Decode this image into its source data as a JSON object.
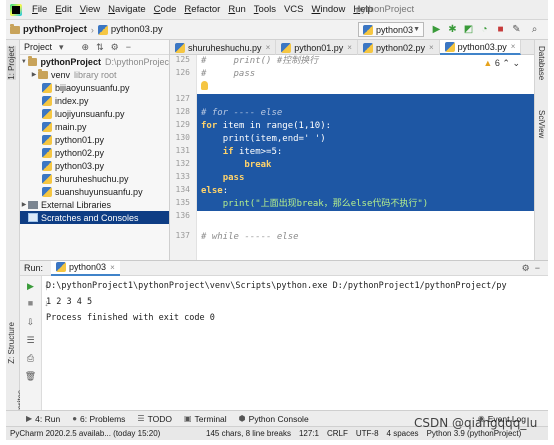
{
  "menubar": {
    "items": [
      {
        "label": "File",
        "mnemonic": "F",
        "rest": "ile"
      },
      {
        "label": "Edit",
        "mnemonic": "E",
        "rest": "dit"
      },
      {
        "label": "View",
        "mnemonic": "V",
        "rest": "iew"
      },
      {
        "label": "Navigate",
        "mnemonic": "N",
        "rest": "avigate"
      },
      {
        "label": "Code",
        "mnemonic": "C",
        "rest": "ode"
      },
      {
        "label": "Refactor",
        "mnemonic": "R",
        "rest": "efactor"
      },
      {
        "label": "Run",
        "mnemonic": "R",
        "rest": "un"
      },
      {
        "label": "Tools",
        "mnemonic": "T",
        "rest": "ools"
      },
      {
        "label": "VCS",
        "mnemonic": "",
        "rest": "VCS"
      },
      {
        "label": "Window",
        "mnemonic": "W",
        "rest": "indow"
      },
      {
        "label": "Help",
        "mnemonic": "H",
        "rest": "elp"
      }
    ],
    "window_title": "pythonProject"
  },
  "navbar": {
    "project": "pythonProject",
    "file": "python03.py",
    "run_config": "python03"
  },
  "left_stripe": {
    "project_tab": "1: Project",
    "structure_tab": "Z: Structure",
    "favorites_tab": "2: Favorites"
  },
  "right_stripe": {
    "database_tab": "Database",
    "sciview_tab": "SciView"
  },
  "project_panel": {
    "header": "Project",
    "root": {
      "name": "pythonProject",
      "path": "D:\\pythonProjec"
    },
    "venv": {
      "name": "venv",
      "note": "library root"
    },
    "files": [
      "bijiaoyunsuanfu.py",
      "index.py",
      "luojiyunsuanfu.py",
      "main.py",
      "python01.py",
      "python02.py",
      "python03.py",
      "shuruheshuchu.py",
      "suanshuyunsuanfu.py"
    ],
    "external_libraries": "External Libraries",
    "scratches": "Scratches and Consoles"
  },
  "editor": {
    "tabs": [
      {
        "label": "shuruheshuchu.py",
        "active": false
      },
      {
        "label": "python01.py",
        "active": false
      },
      {
        "label": "python02.py",
        "active": false
      },
      {
        "label": "python03.py",
        "active": true
      }
    ],
    "warnings": "6",
    "line_numbers": [
      "125",
      "126",
      "127",
      "128",
      "129",
      "130",
      "131",
      "132",
      "133",
      "134",
      "135",
      "136",
      "137"
    ],
    "lines": [
      {
        "pre": "#     ",
        "kw": "",
        "text": "print() #控制换行"
      },
      {
        "pre": "#     ",
        "kw": "",
        "text": "pass"
      },
      {
        "pre": "",
        "kw": "",
        "text": ""
      },
      {
        "pre": "",
        "kw": "",
        "text": "# for ---- else"
      },
      {
        "pre": "",
        "kw": "for",
        "text": " item in range(1,10):"
      },
      {
        "pre": "    ",
        "kw": "",
        "text": "print(item,end=' ')"
      },
      {
        "pre": "    ",
        "kw": "if",
        "text": " item>=5:"
      },
      {
        "pre": "        ",
        "kw": "break",
        "text": ""
      },
      {
        "pre": "    ",
        "kw": "pass",
        "text": ""
      },
      {
        "pre": "",
        "kw": "else",
        "text": ":"
      },
      {
        "pre": "    ",
        "kw": "",
        "text": "print(\"上面出现break，那么else代码不执行\")"
      },
      {
        "pre": "",
        "kw": "",
        "text": ""
      },
      {
        "pre": "",
        "kw": "",
        "text": "# while ----- else"
      }
    ]
  },
  "run_panel": {
    "label": "Run:",
    "tab": "python03",
    "console": [
      "D:\\pythonProject1\\pythonProject\\venv\\Scripts\\python.exe D:/pythonProject1/pythonProject/py",
      "1 2 3 4 5",
      "Process finished with exit code 0"
    ]
  },
  "bottom_tools": {
    "run": "4: Run",
    "problems": "6: Problems",
    "todo": "TODO",
    "terminal": "Terminal",
    "python_console": "Python Console",
    "event_log": "Event Log"
  },
  "statusbar": {
    "message": "PyCharm 2020.2.5 availab... (today 15:20)",
    "selection": "145 chars, 8 line breaks",
    "position": "127:1",
    "line_sep": "CRLF",
    "encoding": "UTF-8",
    "indent": "4 spaces",
    "interpreter": "Python 3.9 (pythonProject)"
  },
  "watermark": "CSDN @qiangqqq_lu",
  "colors": {
    "selection": "#1e57a4",
    "tree_selected": "#0e3d84",
    "accent": "#4083c9"
  }
}
